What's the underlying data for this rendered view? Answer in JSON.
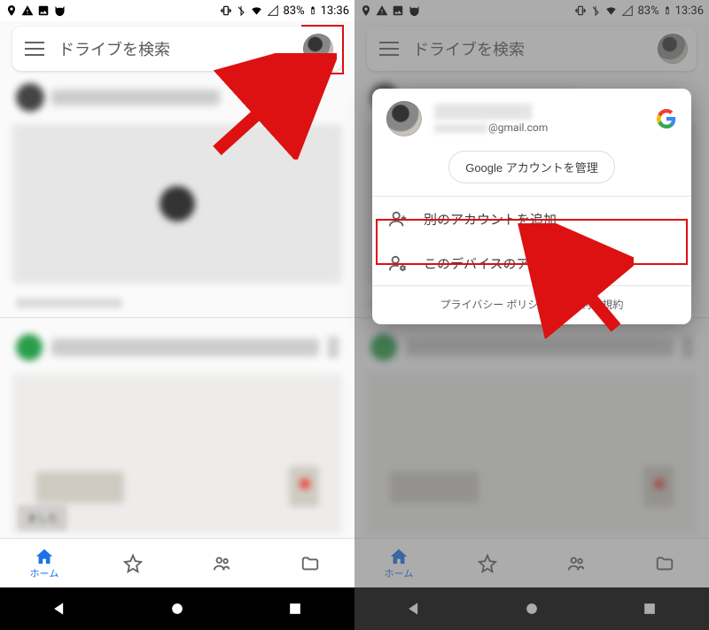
{
  "status": {
    "battery_pct": "83%",
    "time": "13:36"
  },
  "search": {
    "placeholder": "ドライブを検索"
  },
  "nav": {
    "home": "ホーム"
  },
  "snackbar_text": "ました",
  "popup": {
    "email_domain": "@gmail.com",
    "manage_account": "Google アカウントを管理",
    "add_account": "別のアカウントを追加",
    "manage_device_accounts": "このデバイスのアカウントを管理",
    "privacy": "プライバシー ポリシー",
    "terms": "利用規約",
    "dot": "・"
  }
}
